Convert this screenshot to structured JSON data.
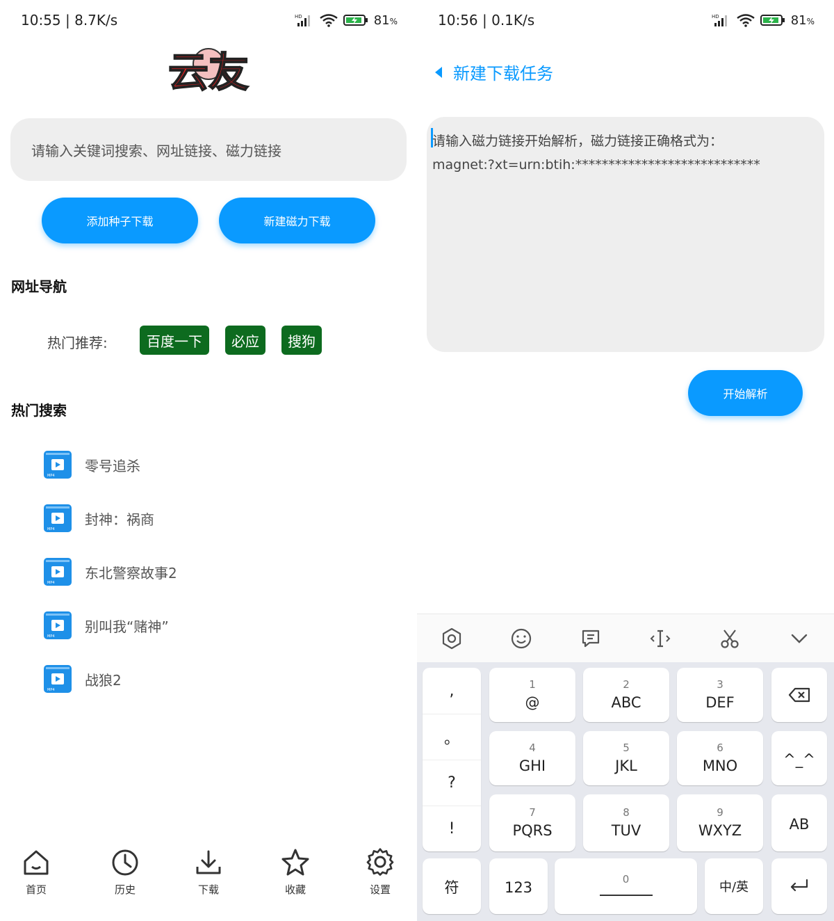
{
  "left": {
    "status": {
      "time": "10:55 | 8.7K/s",
      "battery": "81",
      "battery_unit": "%"
    },
    "logo_text": "云友",
    "search": {
      "placeholder": "请输入关键词搜索、网址链接、磁力链接"
    },
    "buttons": {
      "torrent": "添加种子下载",
      "magnet": "新建磁力下载"
    },
    "nav_section_title": "网址导航",
    "hot_label": "热门推荐:",
    "tags": [
      "百度一下",
      "必应",
      "搜狗"
    ],
    "hot_search_title": "热门搜索",
    "hot_items": [
      "零号追杀",
      "封神：祸商",
      "东北警察故事2",
      "别叫我“赌神”",
      "战狼2"
    ],
    "video_badge": "MP4",
    "bottom_nav": [
      {
        "label": "首页",
        "icon": "home-icon"
      },
      {
        "label": "历史",
        "icon": "clock-icon"
      },
      {
        "label": "下载",
        "icon": "download-icon"
      },
      {
        "label": "收藏",
        "icon": "star-icon"
      },
      {
        "label": "设置",
        "icon": "gear-icon"
      }
    ],
    "accent": "#0a9aff",
    "tag_color": "#0d6b1f"
  },
  "right": {
    "status": {
      "time": "10:56 | 0.1K/s",
      "battery": "81",
      "battery_unit": "%"
    },
    "title": "新建下载任务",
    "magnet_placeholder": "请输入磁力链接开始解析，磁力链接正确格式为：\nmagnet:?xt=urn:btih:****************************",
    "parse_button": "开始解析",
    "keyboard": {
      "punct": [
        ",",
        "。",
        "?",
        "!"
      ],
      "keys": [
        {
          "num": "1",
          "main": "@"
        },
        {
          "num": "2",
          "main": "ABC"
        },
        {
          "num": "3",
          "main": "DEF"
        },
        {
          "num": "4",
          "main": "GHI"
        },
        {
          "num": "5",
          "main": "JKL"
        },
        {
          "num": "6",
          "main": "MNO"
        },
        {
          "num": "7",
          "main": "PQRS"
        },
        {
          "num": "8",
          "main": "TUV"
        },
        {
          "num": "9",
          "main": "WXYZ"
        }
      ],
      "emoticon": "^_^",
      "ab": "AB",
      "symbols": "符",
      "numbers": "123",
      "space_num": "0",
      "lang": "中/英"
    }
  }
}
